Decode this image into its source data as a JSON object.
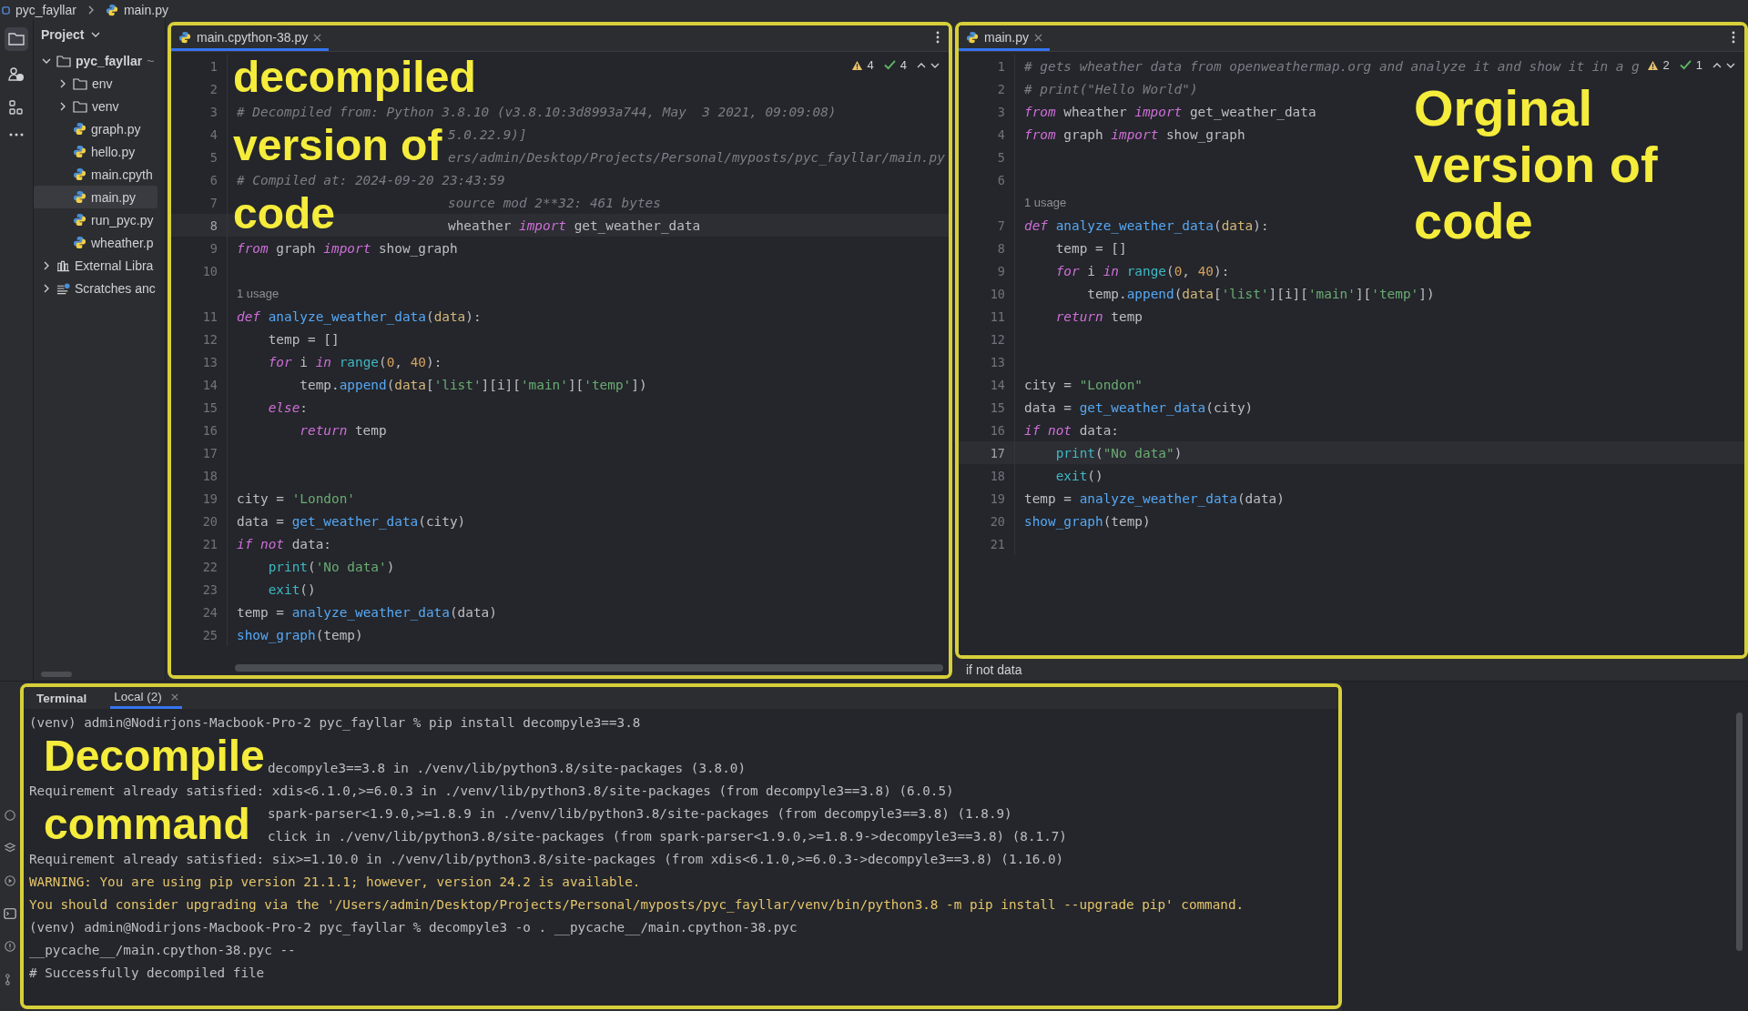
{
  "breadcrumb": [
    "pyc_fayllar",
    "main.py"
  ],
  "project_panel": {
    "title": "Project",
    "tree": [
      {
        "name": "pyc_fayllar",
        "suffix": "~",
        "kind": "folder",
        "expanded": true,
        "selected": false,
        "children": [
          {
            "name": "env",
            "kind": "folder",
            "expanded": false,
            "selected": false
          },
          {
            "name": "venv",
            "kind": "folder",
            "expanded": false,
            "selected": false
          },
          {
            "name": "graph.py",
            "kind": "python",
            "selected": false
          },
          {
            "name": "hello.py",
            "kind": "python",
            "selected": false
          },
          {
            "name": "main.cpyth",
            "kind": "python",
            "selected": false
          },
          {
            "name": "main.py",
            "kind": "python",
            "selected": true
          },
          {
            "name": "run_pyc.py",
            "kind": "python",
            "selected": false
          },
          {
            "name": "wheather.p",
            "kind": "python",
            "selected": false
          }
        ]
      },
      {
        "name": "External Libra",
        "kind": "library",
        "expanded": false,
        "selected": false
      },
      {
        "name": "Scratches anc",
        "kind": "scratch",
        "expanded": false,
        "selected": false
      }
    ]
  },
  "editors": [
    {
      "tab": {
        "label": "main.cpython-38.py",
        "selected": true
      },
      "warnings": "4",
      "checks": "4",
      "annotation": [
        "decompiled",
        "version of",
        "code"
      ],
      "scrollbar": true,
      "lines": [
        {
          "kind": "covered",
          "n": "1",
          "current": false
        },
        {
          "kind": "covered",
          "n": "2",
          "current": false
        },
        {
          "kind": "code",
          "n": "3",
          "current": false,
          "spans": [
            {
              "kind": "c",
              "text": "# Decompiled from: Python 3.8.10 (v3.8.10:3d8993a744, May  3 2021, 09:09:08)"
            }
          ]
        },
        {
          "kind": "covered",
          "n": "4",
          "current": false,
          "spans": [
            {
              "kind": "c",
              "text": "5.0.22.9)]"
            }
          ]
        },
        {
          "kind": "covered",
          "n": "5",
          "current": false,
          "spans": [
            {
              "kind": "c",
              "text": "ers/admin/Desktop/Projects/Personal/myposts/pyc_fayllar/main.py"
            }
          ]
        },
        {
          "kind": "code",
          "n": "6",
          "current": false,
          "spans": [
            {
              "kind": "c",
              "text": "# Compiled at: 2024-09-20 23:43:59"
            }
          ]
        },
        {
          "kind": "covered",
          "n": "7",
          "current": false,
          "spans": [
            {
              "kind": "c",
              "text": "source mod 2**32: 461 bytes"
            }
          ]
        },
        {
          "kind": "covered",
          "n": "8",
          "current": true,
          "spans": [
            {
              "kind": "p",
              "text": "wheather "
            },
            {
              "kind": "k",
              "text": "import"
            },
            {
              "kind": "p",
              "text": " get_weather_data"
            }
          ]
        },
        {
          "kind": "code",
          "n": "9",
          "current": false,
          "spans": [
            {
              "kind": "k",
              "text": "from"
            },
            {
              "kind": "p",
              "text": " graph "
            },
            {
              "kind": "k",
              "text": "import"
            },
            {
              "kind": "p",
              "text": " show_graph"
            }
          ]
        },
        {
          "kind": "code",
          "n": "10",
          "current": false
        },
        {
          "kind": "hint",
          "text": "1 usage"
        },
        {
          "kind": "code",
          "n": "11",
          "current": false,
          "spans": [
            {
              "kind": "k",
              "text": "def"
            },
            {
              "kind": "f",
              "text": " analyze_weather_data"
            },
            {
              "kind": "p",
              "text": "("
            },
            {
              "kind": "a",
              "text": "data"
            },
            {
              "kind": "p",
              "text": "):"
            }
          ]
        },
        {
          "kind": "code",
          "n": "12",
          "current": false,
          "spans": [
            {
              "kind": "p",
              "text": "    temp = []"
            }
          ]
        },
        {
          "kind": "code",
          "n": "13",
          "current": false,
          "spans": [
            {
              "kind": "k",
              "text": "    for"
            },
            {
              "kind": "p",
              "text": " i "
            },
            {
              "kind": "k",
              "text": "in"
            },
            {
              "kind": "b",
              "text": " range"
            },
            {
              "kind": "p",
              "text": "("
            },
            {
              "kind": "n",
              "text": "0"
            },
            {
              "kind": "p",
              "text": ", "
            },
            {
              "kind": "n",
              "text": "40"
            },
            {
              "kind": "p",
              "text": "):"
            }
          ]
        },
        {
          "kind": "code",
          "n": "14",
          "current": false,
          "spans": [
            {
              "kind": "p",
              "text": "        temp."
            },
            {
              "kind": "f",
              "text": "append"
            },
            {
              "kind": "p",
              "text": "("
            },
            {
              "kind": "a",
              "text": "data"
            },
            {
              "kind": "p",
              "text": "["
            },
            {
              "kind": "s",
              "text": "'list'"
            },
            {
              "kind": "p",
              "text": "][i]["
            },
            {
              "kind": "s",
              "text": "'main'"
            },
            {
              "kind": "p",
              "text": "]["
            },
            {
              "kind": "s",
              "text": "'temp'"
            },
            {
              "kind": "p",
              "text": "])"
            }
          ]
        },
        {
          "kind": "code",
          "n": "15",
          "current": false,
          "spans": [
            {
              "kind": "k",
              "text": "    else"
            },
            {
              "kind": "p",
              "text": ":"
            }
          ]
        },
        {
          "kind": "code",
          "n": "16",
          "current": false,
          "spans": [
            {
              "kind": "k",
              "text": "        return"
            },
            {
              "kind": "p",
              "text": " temp"
            }
          ]
        },
        {
          "kind": "code",
          "n": "17",
          "current": false
        },
        {
          "kind": "code",
          "n": "18",
          "current": false
        },
        {
          "kind": "code",
          "n": "19",
          "current": false,
          "spans": [
            {
              "kind": "p",
              "text": "city = "
            },
            {
              "kind": "s",
              "text": "'London'"
            }
          ]
        },
        {
          "kind": "code",
          "n": "20",
          "current": false,
          "spans": [
            {
              "kind": "p",
              "text": "data = "
            },
            {
              "kind": "f",
              "text": "get_weather_data"
            },
            {
              "kind": "p",
              "text": "(city)"
            }
          ]
        },
        {
          "kind": "code",
          "n": "21",
          "current": false,
          "spans": [
            {
              "kind": "k",
              "text": "if"
            },
            {
              "kind": "k",
              "text": " not"
            },
            {
              "kind": "p",
              "text": " data:"
            }
          ]
        },
        {
          "kind": "code",
          "n": "22",
          "current": false,
          "spans": [
            {
              "kind": "b",
              "text": "    print"
            },
            {
              "kind": "p",
              "text": "("
            },
            {
              "kind": "s",
              "text": "'No data'"
            },
            {
              "kind": "p",
              "text": ")"
            }
          ]
        },
        {
          "kind": "code",
          "n": "23",
          "current": false,
          "spans": [
            {
              "kind": "b",
              "text": "    exit"
            },
            {
              "kind": "p",
              "text": "()"
            }
          ]
        },
        {
          "kind": "code",
          "n": "24",
          "current": false,
          "spans": [
            {
              "kind": "p",
              "text": "temp = "
            },
            {
              "kind": "f",
              "text": "analyze_weather_data"
            },
            {
              "kind": "p",
              "text": "(data)"
            }
          ]
        },
        {
          "kind": "code",
          "n": "25",
          "current": false,
          "spans": [
            {
              "kind": "f",
              "text": "show_graph"
            },
            {
              "kind": "p",
              "text": "(temp)"
            }
          ]
        }
      ]
    },
    {
      "tab": {
        "label": "main.py",
        "selected": true
      },
      "warnings": "2",
      "checks": "1",
      "annotation": [
        "Orginal",
        "version of",
        "code"
      ],
      "scrollbar": false,
      "lines": [
        {
          "kind": "code",
          "n": "1",
          "current": false,
          "spans": [
            {
              "kind": "c",
              "text": "# gets wheather data from openweathermap.org and analyze it and show it in a g"
            }
          ]
        },
        {
          "kind": "code",
          "n": "2",
          "current": false,
          "spans": [
            {
              "kind": "c",
              "text": "# print(\"Hello World\")"
            }
          ]
        },
        {
          "kind": "code",
          "n": "3",
          "current": false,
          "spans": [
            {
              "kind": "k",
              "text": "from"
            },
            {
              "kind": "p",
              "text": " wheather "
            },
            {
              "kind": "k",
              "text": "import"
            },
            {
              "kind": "p",
              "text": " get_weather_data"
            }
          ]
        },
        {
          "kind": "code",
          "n": "4",
          "current": false,
          "spans": [
            {
              "kind": "k",
              "text": "from"
            },
            {
              "kind": "p",
              "text": " graph "
            },
            {
              "kind": "k",
              "text": "import"
            },
            {
              "kind": "p",
              "text": " show_graph"
            }
          ]
        },
        {
          "kind": "code",
          "n": "5",
          "current": false
        },
        {
          "kind": "code",
          "n": "6",
          "current": false
        },
        {
          "kind": "hint",
          "text": "1 usage"
        },
        {
          "kind": "code",
          "n": "7",
          "current": false,
          "spans": [
            {
              "kind": "k",
              "text": "def"
            },
            {
              "kind": "f",
              "text": " analyze_weather_data"
            },
            {
              "kind": "p",
              "text": "("
            },
            {
              "kind": "a",
              "text": "data"
            },
            {
              "kind": "p",
              "text": "):"
            }
          ]
        },
        {
          "kind": "code",
          "n": "8",
          "current": false,
          "spans": [
            {
              "kind": "p",
              "text": "    temp = []"
            }
          ]
        },
        {
          "kind": "code",
          "n": "9",
          "current": false,
          "spans": [
            {
              "kind": "k",
              "text": "    for"
            },
            {
              "kind": "p",
              "text": " i "
            },
            {
              "kind": "k",
              "text": "in"
            },
            {
              "kind": "b",
              "text": " range"
            },
            {
              "kind": "p",
              "text": "("
            },
            {
              "kind": "n",
              "text": "0"
            },
            {
              "kind": "p",
              "text": ", "
            },
            {
              "kind": "n",
              "text": "40"
            },
            {
              "kind": "p",
              "text": "):"
            }
          ]
        },
        {
          "kind": "code",
          "n": "10",
          "current": false,
          "spans": [
            {
              "kind": "p",
              "text": "        temp."
            },
            {
              "kind": "f",
              "text": "append"
            },
            {
              "kind": "p",
              "text": "("
            },
            {
              "kind": "a",
              "text": "data"
            },
            {
              "kind": "p",
              "text": "["
            },
            {
              "kind": "s",
              "text": "'list'"
            },
            {
              "kind": "p",
              "text": "][i]["
            },
            {
              "kind": "s",
              "text": "'main'"
            },
            {
              "kind": "p",
              "text": "]["
            },
            {
              "kind": "s",
              "text": "'temp'"
            },
            {
              "kind": "p",
              "text": "])"
            }
          ]
        },
        {
          "kind": "code",
          "n": "11",
          "current": false,
          "spans": [
            {
              "kind": "k",
              "text": "    return"
            },
            {
              "kind": "p",
              "text": " temp"
            }
          ]
        },
        {
          "kind": "code",
          "n": "12",
          "current": false
        },
        {
          "kind": "code",
          "n": "13",
          "current": false
        },
        {
          "kind": "code",
          "n": "14",
          "current": false,
          "spans": [
            {
              "kind": "p",
              "text": "city = "
            },
            {
              "kind": "s",
              "text": "\"London\""
            }
          ]
        },
        {
          "kind": "code",
          "n": "15",
          "current": false,
          "spans": [
            {
              "kind": "p",
              "text": "data = "
            },
            {
              "kind": "f",
              "text": "get_weather_data"
            },
            {
              "kind": "p",
              "text": "(city)"
            }
          ]
        },
        {
          "kind": "code",
          "n": "16",
          "current": false,
          "spans": [
            {
              "kind": "k",
              "text": "if"
            },
            {
              "kind": "k",
              "text": " not"
            },
            {
              "kind": "p",
              "text": " data:"
            }
          ]
        },
        {
          "kind": "code",
          "n": "17",
          "current": true,
          "spans": [
            {
              "kind": "b",
              "text": "    print"
            },
            {
              "kind": "p",
              "text": "("
            },
            {
              "kind": "s",
              "text": "\"No data\""
            },
            {
              "kind": "p",
              "text": ")"
            }
          ]
        },
        {
          "kind": "code",
          "n": "18",
          "current": false,
          "spans": [
            {
              "kind": "b",
              "text": "    exit"
            },
            {
              "kind": "p",
              "text": "()"
            }
          ]
        },
        {
          "kind": "code",
          "n": "19",
          "current": false,
          "spans": [
            {
              "kind": "p",
              "text": "temp = "
            },
            {
              "kind": "f",
              "text": "analyze_weather_data"
            },
            {
              "kind": "p",
              "text": "(data)"
            }
          ]
        },
        {
          "kind": "code",
          "n": "20",
          "current": false,
          "spans": [
            {
              "kind": "f",
              "text": "show_graph"
            },
            {
              "kind": "p",
              "text": "(temp)"
            }
          ]
        },
        {
          "kind": "code",
          "n": "21",
          "current": false
        }
      ]
    }
  ],
  "status_line": "if not data",
  "terminal": {
    "title": "Terminal",
    "tabs": [
      {
        "label": "Local (2)",
        "selected": true
      }
    ],
    "annotation": [
      "Decompile",
      "command"
    ],
    "lines": [
      {
        "kind": "normal",
        "text": "(venv) admin@Nodirjons-Macbook-Pro-2 pyc_fayllar % pip install decompyle3==3.8"
      },
      {
        "kind": "blank"
      },
      {
        "kind": "covered",
        "text": "decompyle3==3.8 in ./venv/lib/python3.8/site-packages (3.8.0)"
      },
      {
        "kind": "normal",
        "text": "Requirement already satisfied: xdis<6.1.0,>=6.0.3 in ./venv/lib/python3.8/site-packages (from decompyle3==3.8) (6.0.5)"
      },
      {
        "kind": "covered",
        "text": "spark-parser<1.9.0,>=1.8.9 in ./venv/lib/python3.8/site-packages (from decompyle3==3.8) (1.8.9)"
      },
      {
        "kind": "covered",
        "text": "click in ./venv/lib/python3.8/site-packages (from spark-parser<1.9.0,>=1.8.9->decompyle3==3.8) (8.1.7)"
      },
      {
        "kind": "normal",
        "text": "Requirement already satisfied: six>=1.10.0 in ./venv/lib/python3.8/site-packages (from xdis<6.1.0,>=6.0.3->decompyle3==3.8) (1.16.0)"
      },
      {
        "kind": "warning",
        "text": "WARNING: You are using pip version 21.1.1; however, version 24.2 is available."
      },
      {
        "kind": "warning",
        "text": "You should consider upgrading via the '/Users/admin/Desktop/Projects/Personal/myposts/pyc_fayllar/venv/bin/python3.8 -m pip install --upgrade pip' command."
      },
      {
        "kind": "normal",
        "text": "(venv) admin@Nodirjons-Macbook-Pro-2 pyc_fayllar % decompyle3 -o . __pycache__/main.cpython-38.pyc"
      },
      {
        "kind": "normal",
        "text": "__pycache__/main.cpython-38.pyc --"
      },
      {
        "kind": "normal",
        "text": "# Successfully decompiled file"
      }
    ]
  }
}
